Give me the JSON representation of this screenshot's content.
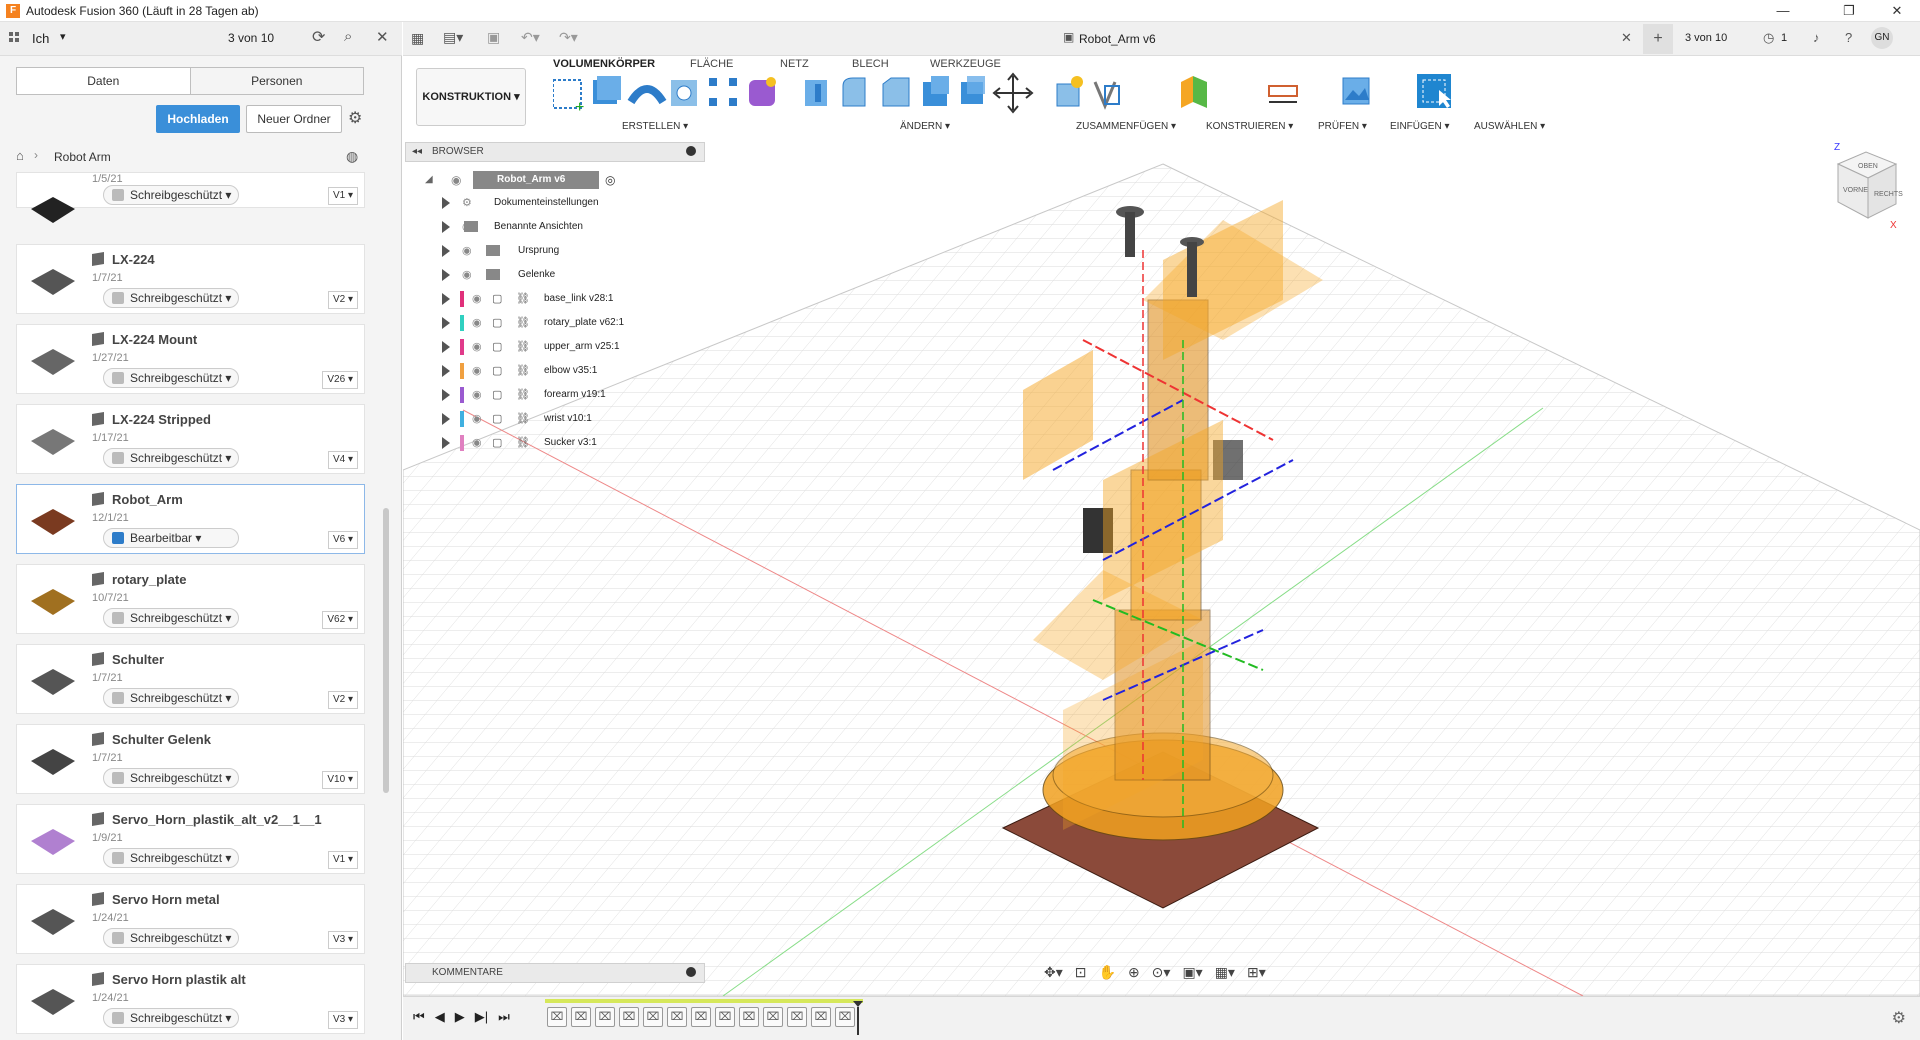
{
  "window": {
    "title": "Autodesk Fusion 360 (Läuft in 28 Tagen ab)",
    "controls": [
      "—",
      "❐",
      "✕"
    ]
  },
  "left_panel": {
    "user": "Ich",
    "counter": "3 von 10",
    "tabs": [
      "Daten",
      "Personen"
    ],
    "upload_label": "Hochladen",
    "new_folder_label": "Neuer Ordner",
    "breadcrumb": "Robot Arm",
    "items": [
      {
        "name": "",
        "date": "1/5/21",
        "status": "Schreibgeschützt",
        "version": "V1"
      },
      {
        "name": "LX-224",
        "date": "1/7/21",
        "status": "Schreibgeschützt",
        "version": "V2"
      },
      {
        "name": "LX-224 Mount",
        "date": "1/27/21",
        "status": "Schreibgeschützt",
        "version": "V26"
      },
      {
        "name": "LX-224 Stripped",
        "date": "1/17/21",
        "status": "Schreibgeschützt",
        "version": "V4"
      },
      {
        "name": "Robot_Arm",
        "date": "12/1/21",
        "status": "Bearbeitbar",
        "version": "V6"
      },
      {
        "name": "rotary_plate",
        "date": "10/7/21",
        "status": "Schreibgeschützt",
        "version": "V62"
      },
      {
        "name": "Schulter",
        "date": "1/7/21",
        "status": "Schreibgeschützt",
        "version": "V2"
      },
      {
        "name": "Schulter Gelenk",
        "date": "1/7/21",
        "status": "Schreibgeschützt",
        "version": "V10"
      },
      {
        "name": "Servo_Horn_plastik_alt_v2__1__1",
        "date": "1/9/21",
        "status": "Schreibgeschützt",
        "version": "V1"
      },
      {
        "name": "Servo Horn metal",
        "date": "1/24/21",
        "status": "Schreibgeschützt",
        "version": "V3"
      },
      {
        "name": "Servo Horn plastik alt",
        "date": "1/24/21",
        "status": "Schreibgeschützt",
        "version": "V3"
      }
    ]
  },
  "document": {
    "tab_title": "Robot_Arm v6",
    "counter": "3 von 10",
    "jobs": "1",
    "user_initials": "GN"
  },
  "ribbon": {
    "workspace": "KONSTRUKTION",
    "tabs": [
      "VOLUMENKÖRPER",
      "FLÄCHE",
      "NETZ",
      "BLECH",
      "WERKZEUGE"
    ],
    "groups": [
      "ERSTELLEN",
      "ÄNDERN",
      "ZUSAMMENFÜGEN",
      "KONSTRUIEREN",
      "PRÜFEN",
      "EINFÜGEN",
      "AUSWÄHLEN"
    ]
  },
  "browser": {
    "header": "BROWSER",
    "root": "Robot_Arm v6",
    "nodes": [
      {
        "label": "Dokumenteinstellungen",
        "color": ""
      },
      {
        "label": "Benannte Ansichten",
        "color": ""
      },
      {
        "label": "Ursprung",
        "color": ""
      },
      {
        "label": "Gelenke",
        "color": ""
      },
      {
        "label": "base_link v28:1",
        "color": "#e0307a"
      },
      {
        "label": "rotary_plate v62:1",
        "color": "#30d0c0"
      },
      {
        "label": "upper_arm v25:1",
        "color": "#e03a8a"
      },
      {
        "label": "elbow v35:1",
        "color": "#f0a040"
      },
      {
        "label": "forearm v19:1",
        "color": "#9a5ad0"
      },
      {
        "label": "wrist v10:1",
        "color": "#40b0e0"
      },
      {
        "label": "Sucker v3:1",
        "color": "#e080c0"
      }
    ]
  },
  "viewcube": {
    "top": "OBEN",
    "front": "VORNE",
    "right": "RECHTS"
  },
  "comments": {
    "header": "KOMMENTARE"
  },
  "colors": {
    "accent": "#3a8fd9",
    "bg_panel": "#f4f4f4",
    "model_orange": "#f5a623",
    "base_plate": "#8b4a3a"
  }
}
